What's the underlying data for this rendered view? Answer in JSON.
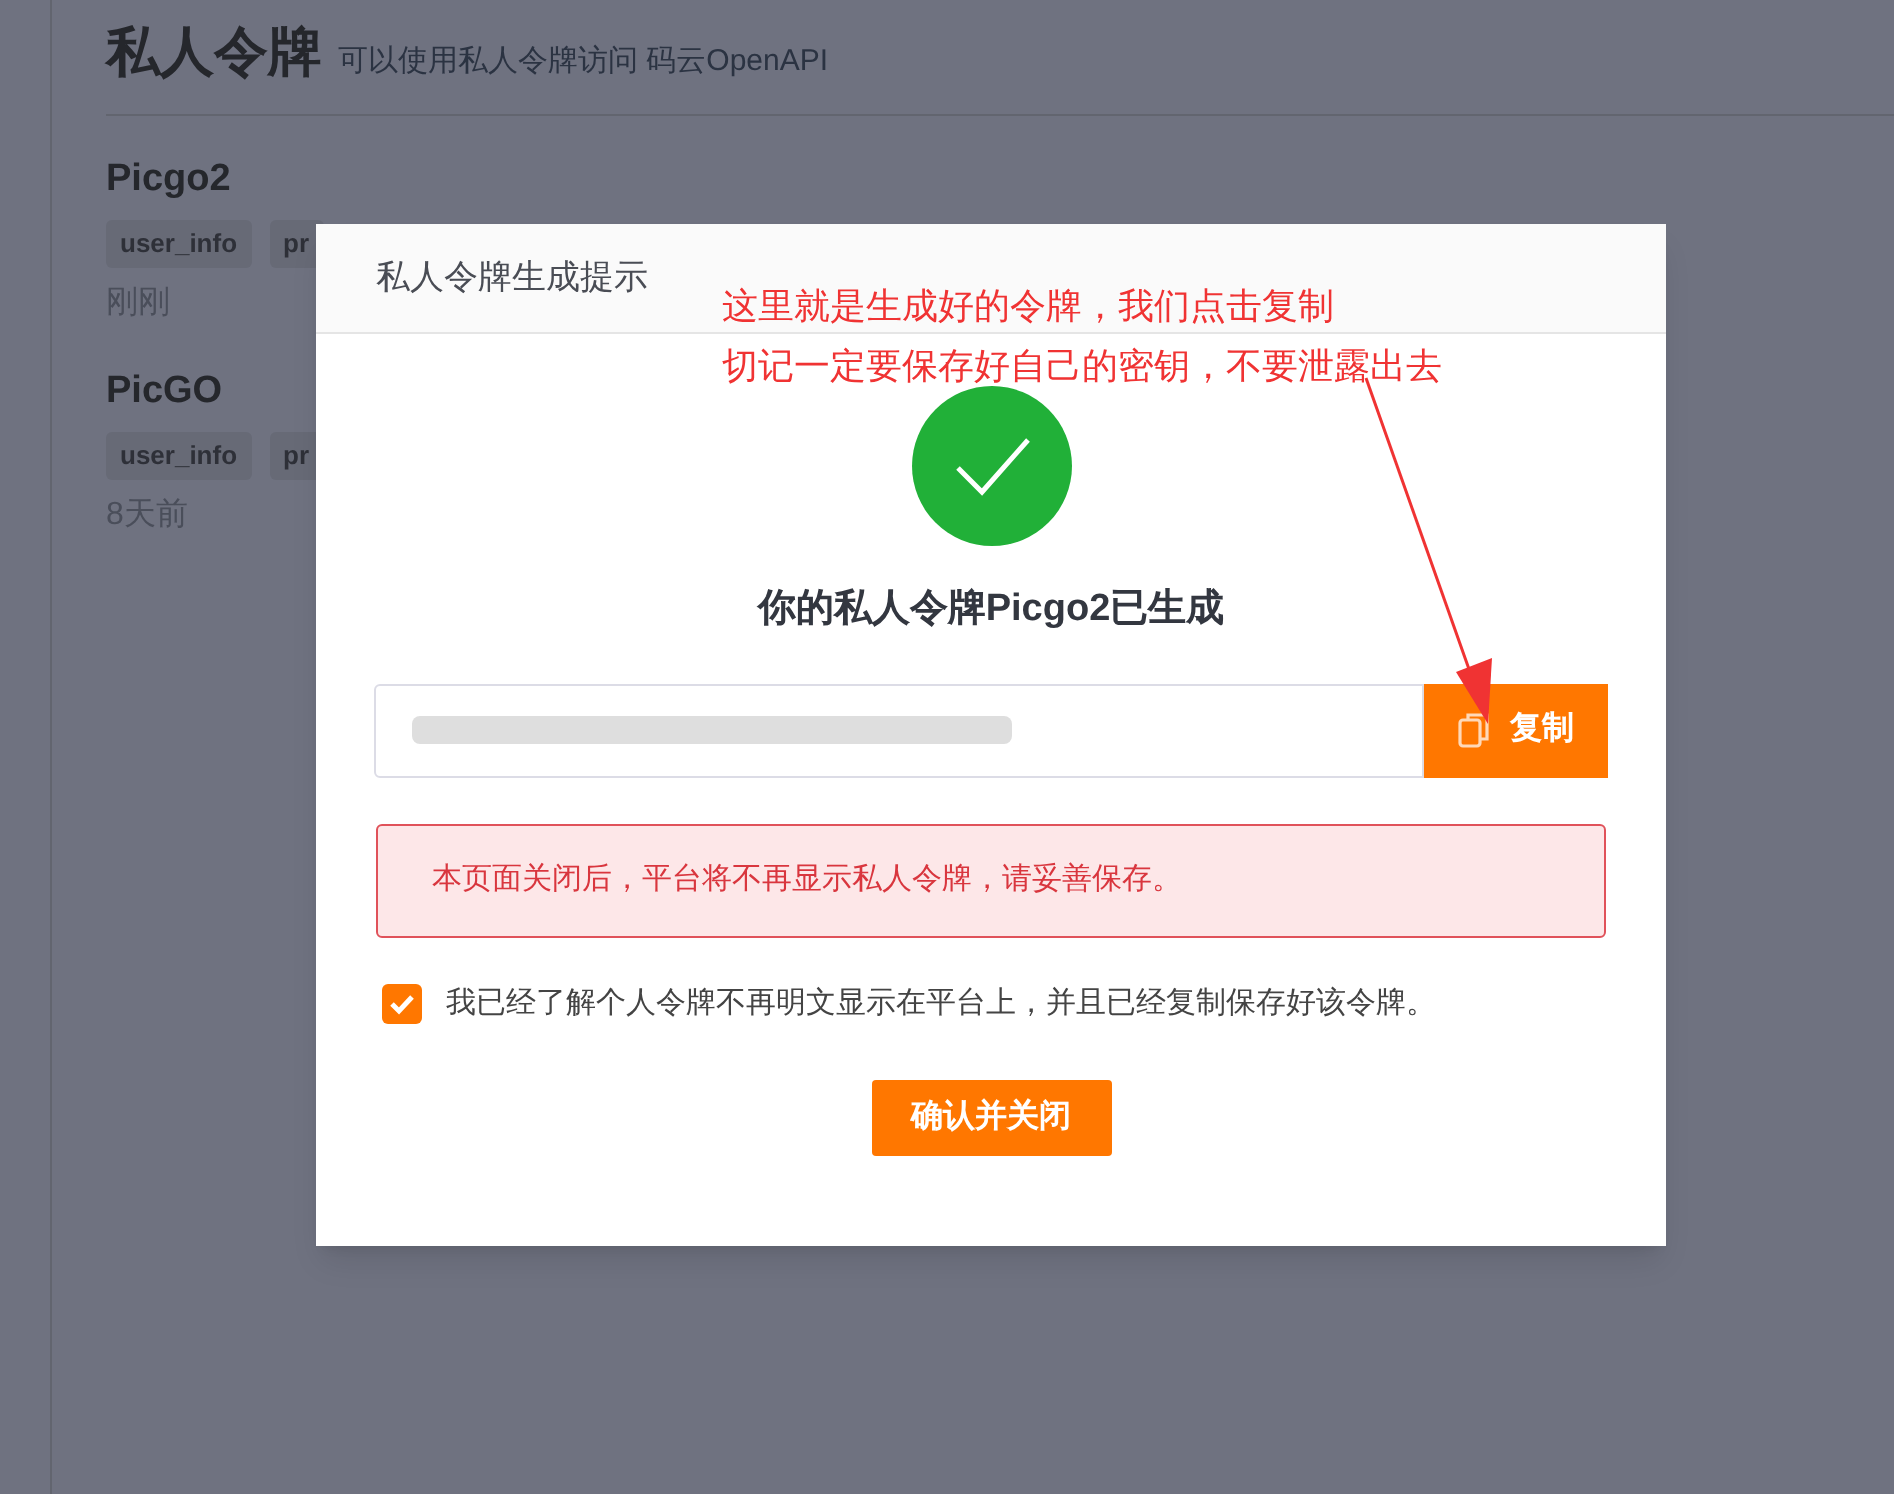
{
  "page": {
    "title": "私人令牌",
    "subtitle": "可以使用私人令牌访问 码云OpenAPI"
  },
  "tokens": [
    {
      "name": "Picgo2",
      "scopes": [
        "user_info",
        "pr"
      ],
      "time": "刚刚"
    },
    {
      "name": "PicGO",
      "scopes": [
        "user_info",
        "pr"
      ],
      "time": "8天前"
    }
  ],
  "dialog": {
    "title": "私人令牌生成提示",
    "heading": "你的私人令牌Picgo2已生成",
    "copy_button": "复制",
    "warning": "本页面关闭后，平台将不再显示私人令牌，请妥善保存。",
    "confirm": {
      "label": "我已经了解个人令牌不再明文显示在平台上，并且已经复制保存好该令牌。",
      "checked": true
    },
    "close_button": "确认并关闭"
  },
  "annotation": [
    "这里就是生成好的令牌，我们点击复制",
    "切记一定要保存好自己的密钥，不要泄露出去"
  ]
}
